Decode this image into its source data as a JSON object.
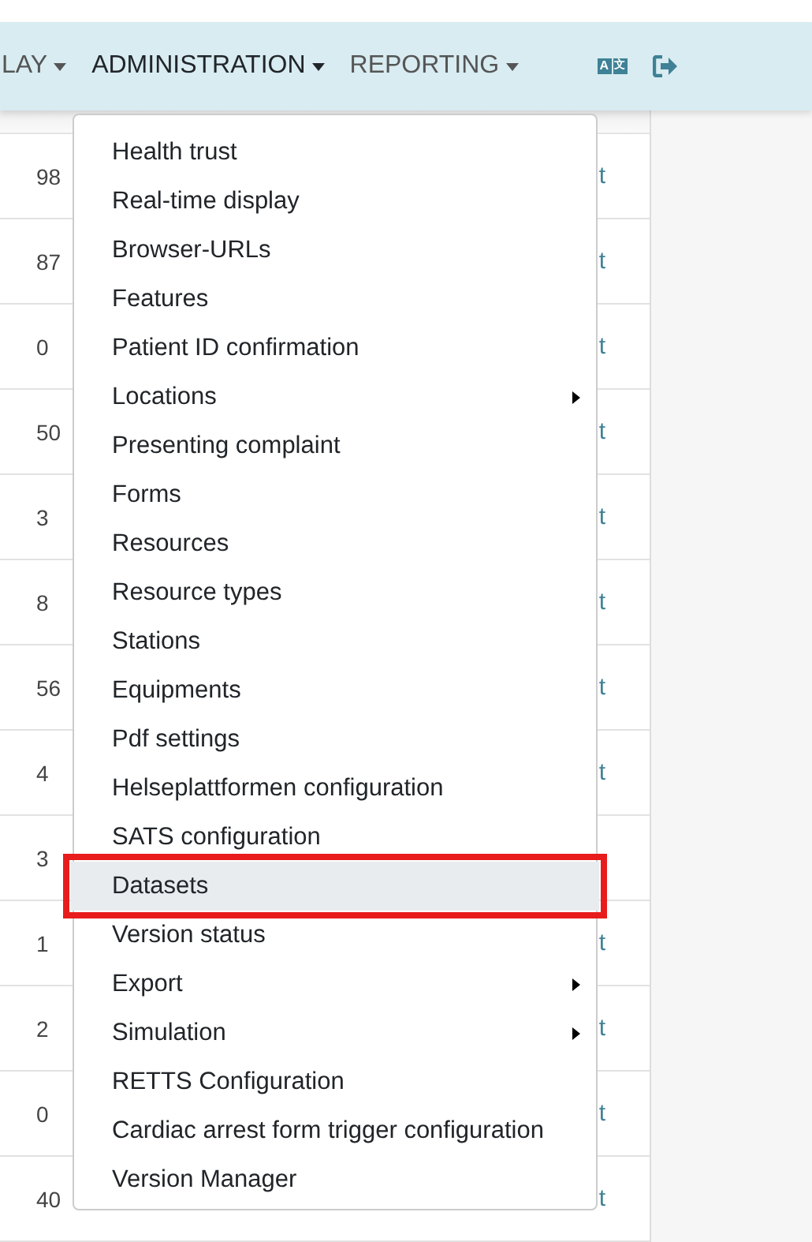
{
  "nav": {
    "items": [
      {
        "label": "LAY",
        "selected": false
      },
      {
        "label": "ADMINISTRATION",
        "selected": true
      },
      {
        "label": "REPORTING",
        "selected": false
      }
    ],
    "language_icon": {
      "letters": [
        "A",
        "文"
      ]
    }
  },
  "table": {
    "rows": [
      {
        "number": "98",
        "link": "t"
      },
      {
        "number": "87",
        "link": "t"
      },
      {
        "number": "0",
        "link": "t"
      },
      {
        "number": "50",
        "link": "t"
      },
      {
        "number": "3",
        "link": "t"
      },
      {
        "number": "8",
        "link": "t"
      },
      {
        "number": "56",
        "link": "t"
      },
      {
        "number": "4",
        "link": "t"
      },
      {
        "number": "3"
      },
      {
        "number": "1",
        "link": "t"
      },
      {
        "number": "2",
        "link": "t"
      },
      {
        "number": "0",
        "link": "t"
      },
      {
        "number": "40",
        "link": "t"
      }
    ]
  },
  "menu": {
    "items": [
      {
        "label": "Health trust",
        "submenu": false,
        "selected": false
      },
      {
        "label": "Real-time display",
        "submenu": false,
        "selected": false
      },
      {
        "label": "Browser-URLs",
        "submenu": false,
        "selected": false
      },
      {
        "label": "Features",
        "submenu": false,
        "selected": false
      },
      {
        "label": "Patient ID confirmation",
        "submenu": false,
        "selected": false
      },
      {
        "label": "Locations",
        "submenu": true,
        "selected": false
      },
      {
        "label": "Presenting complaint",
        "submenu": false,
        "selected": false
      },
      {
        "label": "Forms",
        "submenu": false,
        "selected": false
      },
      {
        "label": "Resources",
        "submenu": false,
        "selected": false
      },
      {
        "label": "Resource types",
        "submenu": false,
        "selected": false
      },
      {
        "label": "Stations",
        "submenu": false,
        "selected": false
      },
      {
        "label": "Equipments",
        "submenu": false,
        "selected": false
      },
      {
        "label": "Pdf settings",
        "submenu": false,
        "selected": false
      },
      {
        "label": "Helseplattformen configuration",
        "submenu": false,
        "selected": false
      },
      {
        "label": "SATS configuration",
        "submenu": false,
        "selected": false
      },
      {
        "label": "Datasets",
        "submenu": false,
        "selected": true
      },
      {
        "label": "Version status",
        "submenu": false,
        "selected": false
      },
      {
        "label": "Export",
        "submenu": true,
        "selected": false
      },
      {
        "label": "Simulation",
        "submenu": true,
        "selected": false
      },
      {
        "label": "RETTS Configuration",
        "submenu": false,
        "selected": false
      },
      {
        "label": "Cardiac arrest form trigger configuration",
        "submenu": false,
        "selected": false
      },
      {
        "label": "Version Manager",
        "submenu": false,
        "selected": false
      }
    ]
  }
}
